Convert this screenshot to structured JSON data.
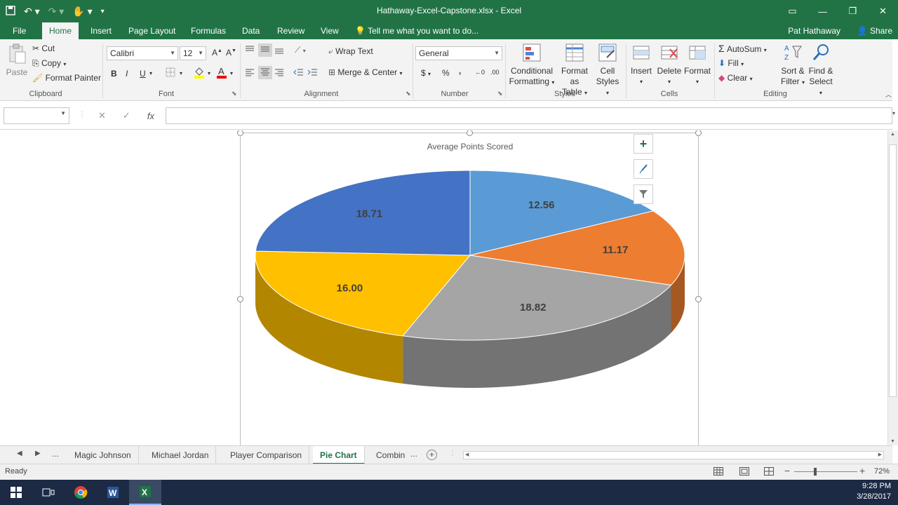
{
  "window": {
    "title": "Hathaway-Excel-Capstone.xlsx - Excel"
  },
  "menu": {
    "tabs": [
      "File",
      "Home",
      "Insert",
      "Page Layout",
      "Formulas",
      "Data",
      "Review",
      "View"
    ],
    "tell_me": "Tell me what you want to do...",
    "user": "Pat Hathaway",
    "share": "Share"
  },
  "ribbon": {
    "clipboard": {
      "paste": "Paste",
      "cut": "Cut",
      "copy": "Copy",
      "format_painter": "Format Painter",
      "label": "Clipboard"
    },
    "font": {
      "name": "Calibri",
      "size": "12",
      "bold": "B",
      "italic": "I",
      "underline": "U",
      "label": "Font"
    },
    "alignment": {
      "wrap": "Wrap Text",
      "merge": "Merge & Center",
      "label": "Alignment"
    },
    "number": {
      "format": "General",
      "currency": "$",
      "percent": "%",
      "comma": ",",
      "label": "Number"
    },
    "styles": {
      "conditional_1": "Conditional",
      "conditional_2": "Formatting",
      "format_table_1": "Format as",
      "format_table_2": "Table",
      "cell_styles_1": "Cell",
      "cell_styles_2": "Styles",
      "label": "Styles"
    },
    "cells": {
      "insert": "Insert",
      "delete": "Delete",
      "format": "Format",
      "label": "Cells"
    },
    "editing": {
      "autosum": "AutoSum",
      "fill": "Fill",
      "clear": "Clear",
      "sort_1": "Sort &",
      "sort_2": "Filter",
      "find_1": "Find &",
      "find_2": "Select",
      "label": "Editing"
    }
  },
  "formula_bar": {
    "name_box": "",
    "fx": "fx",
    "content": ""
  },
  "chart_data": {
    "type": "pie",
    "title": "Average Points Scored",
    "three_d": true,
    "values": [
      12.56,
      11.17,
      18.82,
      16.0,
      18.71
    ],
    "labels": [
      "12.56",
      "11.17",
      "18.82",
      "16.00",
      "18.71"
    ],
    "colors": [
      "#5b9bd5",
      "#ed7d31",
      "#a5a5a5",
      "#ffc000",
      "#4472c4"
    ]
  },
  "sheet_tabs": {
    "ellipsis": "...",
    "tabs": [
      "Magic Johnson",
      "Michael Jordan",
      "Player Comparison",
      "Pie Chart",
      "Combin"
    ],
    "active": "Pie Chart",
    "more": "..."
  },
  "status": {
    "ready": "Ready",
    "zoom": "72%"
  },
  "taskbar": {
    "time": "9:28 PM",
    "date": "3/28/2017"
  },
  "colors": {
    "excel_green": "#217346"
  }
}
